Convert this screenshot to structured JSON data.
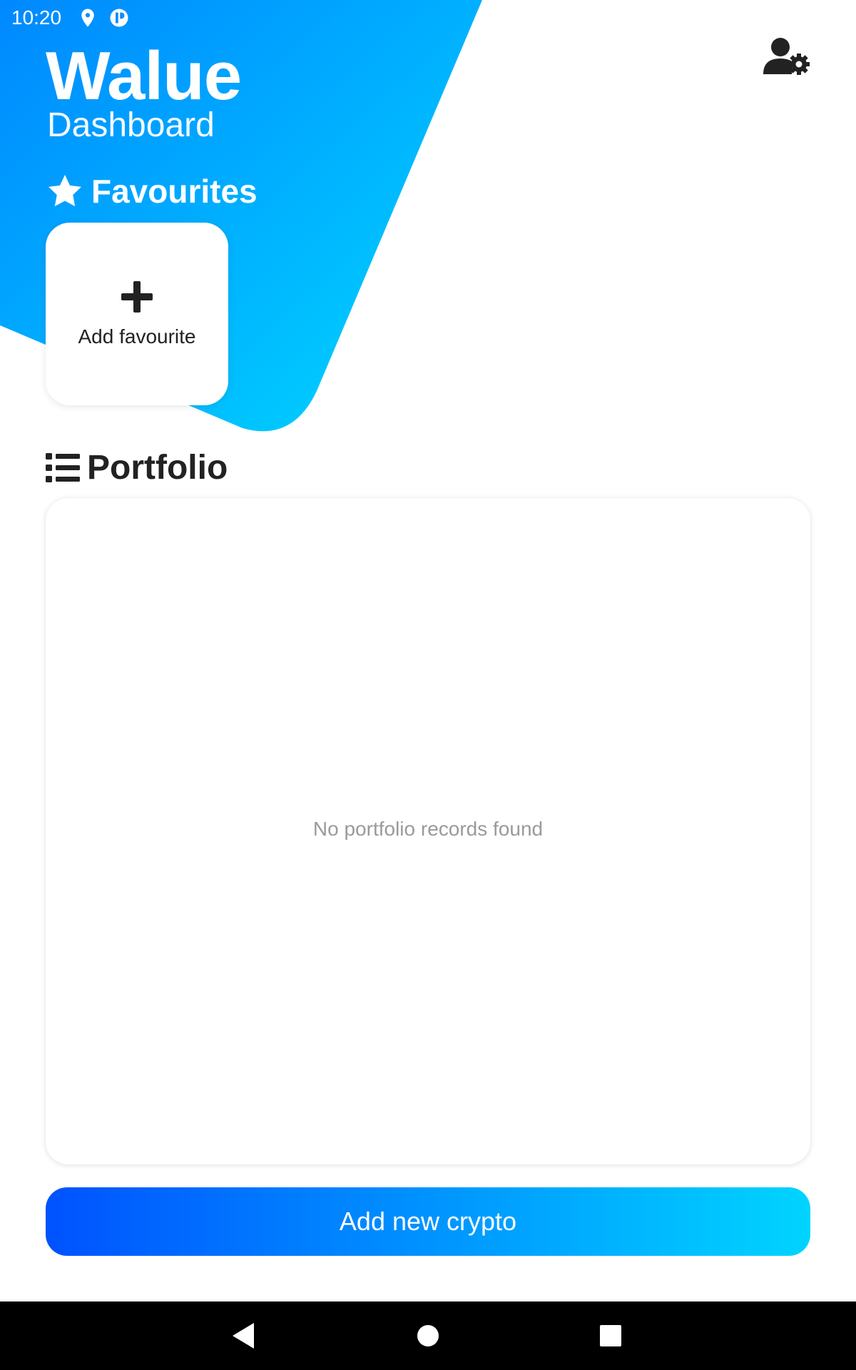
{
  "status_bar": {
    "time": "10:20",
    "icons": [
      "location-pin-icon",
      "app-notification-icon"
    ]
  },
  "header": {
    "title": "Walue",
    "subtitle": "Dashboard",
    "settings_icon": "user-settings-icon"
  },
  "favourites": {
    "heading": "Favourites",
    "heading_icon": "star-icon",
    "add_label": "Add favourite",
    "add_icon": "plus-icon"
  },
  "portfolio": {
    "heading": "Portfolio",
    "heading_icon": "list-icon",
    "empty_text": "No portfolio records found"
  },
  "actions": {
    "add_crypto_label": "Add new crypto"
  },
  "nav": {
    "items": [
      "back-icon",
      "home-icon",
      "recents-icon"
    ]
  },
  "colors": {
    "hero_gradient_start": "#0a8cff",
    "hero_gradient_end": "#00d2ff",
    "button_gradient_start": "#0052ff",
    "button_gradient_end": "#00d4ff",
    "text_dark": "#222222",
    "empty_text": "#9a9a9a"
  }
}
